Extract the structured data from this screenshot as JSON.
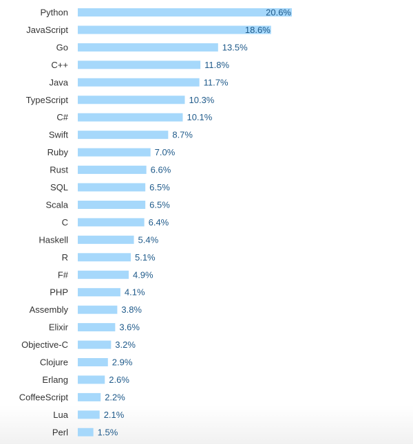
{
  "chart_data": {
    "type": "bar",
    "orientation": "horizontal",
    "title": "",
    "xlabel": "",
    "ylabel": "",
    "grid": false,
    "legend": "none",
    "unit": "%",
    "xlim": [
      0,
      20.6
    ],
    "bar_color": "#a6d8fb",
    "value_label_color": "#1f5a8a",
    "category_label_color": "#333333",
    "categories": [
      "Python",
      "JavaScript",
      "Go",
      "C++",
      "Java",
      "TypeScript",
      "C#",
      "Swift",
      "Ruby",
      "Rust",
      "SQL",
      "Scala",
      "C",
      "Haskell",
      "R",
      "F#",
      "PHP",
      "Assembly",
      "Elixir",
      "Objective-C",
      "Clojure",
      "Erlang",
      "CoffeeScript",
      "Lua",
      "Perl"
    ],
    "values": [
      20.6,
      18.6,
      13.5,
      11.8,
      11.7,
      10.3,
      10.1,
      8.7,
      7.0,
      6.6,
      6.5,
      6.5,
      6.4,
      5.4,
      5.1,
      4.9,
      4.1,
      3.8,
      3.6,
      3.2,
      2.9,
      2.6,
      2.2,
      2.1,
      1.5
    ],
    "value_labels": [
      "20.6%",
      "18.6%",
      "13.5%",
      "11.8%",
      "11.7%",
      "10.3%",
      "10.1%",
      "8.7%",
      "7.0%",
      "6.6%",
      "6.5%",
      "6.5%",
      "6.4%",
      "5.4%",
      "5.1%",
      "4.9%",
      "4.1%",
      "3.8%",
      "3.6%",
      "3.2%",
      "2.9%",
      "2.6%",
      "2.2%",
      "2.1%",
      "1.5%"
    ]
  }
}
